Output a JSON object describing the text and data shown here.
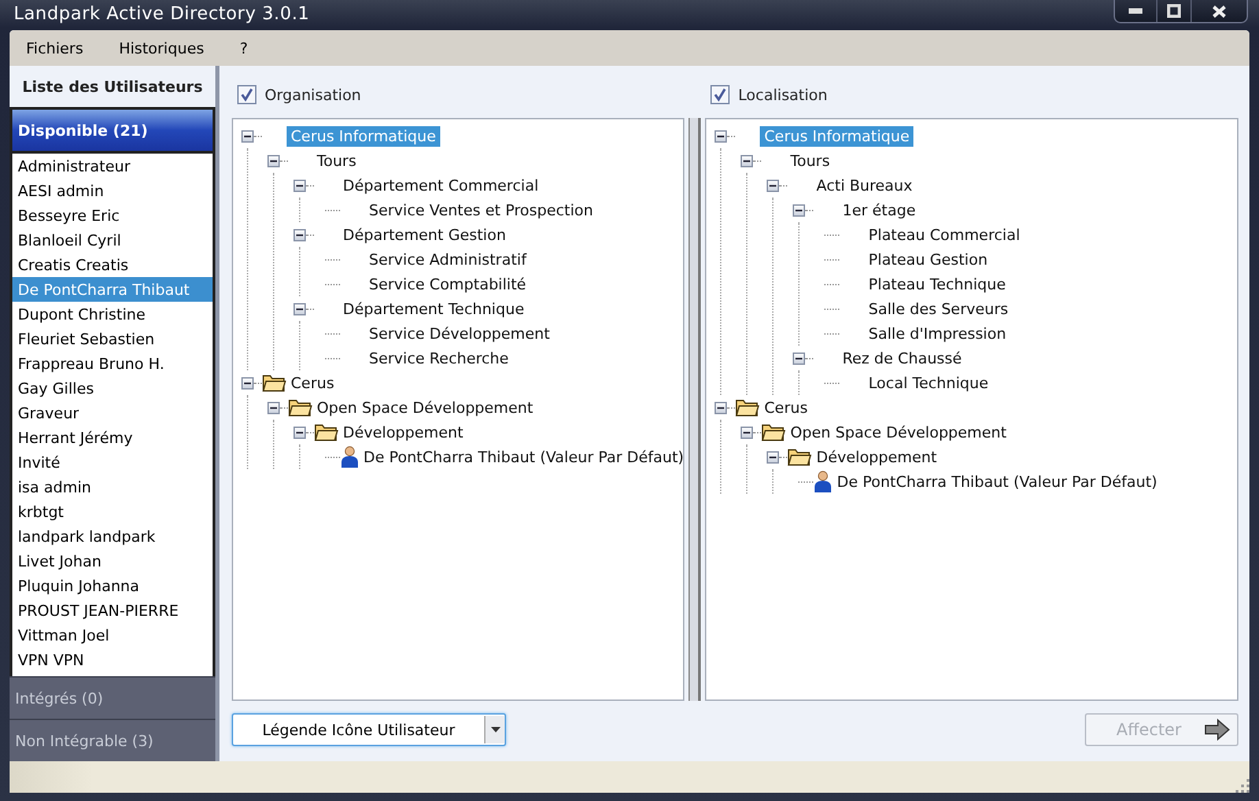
{
  "window": {
    "title": "Landpark Active Directory 3.0.1"
  },
  "menu": [
    "Fichiers",
    "Historiques",
    "?"
  ],
  "sidebar": {
    "title": "Liste des Utilisateurs",
    "groups": [
      {
        "label": "Disponible (21)",
        "selected": true,
        "users": [
          {
            "name": "Administrateur",
            "selected": false
          },
          {
            "name": "AESI admin",
            "selected": false
          },
          {
            "name": "Besseyre Eric",
            "selected": false
          },
          {
            "name": "Blanloeil Cyril",
            "selected": false
          },
          {
            "name": "Creatis Creatis",
            "selected": false
          },
          {
            "name": "De PontCharra Thibaut",
            "selected": true
          },
          {
            "name": "Dupont Christine",
            "selected": false
          },
          {
            "name": "Fleuriet Sebastien",
            "selected": false
          },
          {
            "name": "Frappreau Bruno H.",
            "selected": false
          },
          {
            "name": "Gay Gilles",
            "selected": false
          },
          {
            "name": "Graveur",
            "selected": false
          },
          {
            "name": "Herrant Jérémy",
            "selected": false
          },
          {
            "name": "Invité",
            "selected": false
          },
          {
            "name": "isa admin",
            "selected": false
          },
          {
            "name": "krbtgt",
            "selected": false
          },
          {
            "name": "landpark landpark",
            "selected": false
          },
          {
            "name": "Livet Johan",
            "selected": false
          },
          {
            "name": "Pluquin Johanna",
            "selected": false
          },
          {
            "name": "PROUST JEAN-PIERRE",
            "selected": false
          },
          {
            "name": "Vittman Joel",
            "selected": false
          },
          {
            "name": "VPN VPN",
            "selected": false
          }
        ]
      },
      {
        "label": "Intégrés (0)",
        "selected": false
      },
      {
        "label": "Non Intégrable (3)",
        "selected": false
      }
    ]
  },
  "panels": [
    {
      "label": "Organisation",
      "checked": true,
      "tree": [
        {
          "label": "Cerus Informatique",
          "kind": "node",
          "selected": true,
          "expanded": true,
          "children": [
            {
              "label": "Tours",
              "kind": "node",
              "selected": false,
              "expanded": true,
              "children": [
                {
                  "label": "Département Commercial",
                  "kind": "node",
                  "selected": false,
                  "expanded": true,
                  "children": [
                    {
                      "label": "Service Ventes et Prospection",
                      "kind": "node",
                      "selected": false
                    }
                  ]
                },
                {
                  "label": "Département Gestion",
                  "kind": "node",
                  "selected": false,
                  "expanded": true,
                  "children": [
                    {
                      "label": "Service Administratif",
                      "kind": "node",
                      "selected": false
                    },
                    {
                      "label": "Service Comptabilité",
                      "kind": "node",
                      "selected": false
                    }
                  ]
                },
                {
                  "label": "Département Technique",
                  "kind": "node",
                  "selected": false,
                  "expanded": true,
                  "children": [
                    {
                      "label": "Service Développement",
                      "kind": "node",
                      "selected": false
                    },
                    {
                      "label": "Service Recherche",
                      "kind": "node",
                      "selected": false
                    }
                  ]
                }
              ]
            }
          ]
        },
        {
          "label": "Cerus",
          "kind": "folder",
          "selected": false,
          "expanded": true,
          "children": [
            {
              "label": "Open Space Développement",
              "kind": "folder",
              "selected": false,
              "expanded": true,
              "children": [
                {
                  "label": "Développement",
                  "kind": "folder",
                  "selected": false,
                  "expanded": true,
                  "children": [
                    {
                      "label": "De PontCharra Thibaut (Valeur Par Défaut)",
                      "kind": "user",
                      "selected": false
                    }
                  ]
                }
              ]
            }
          ]
        }
      ]
    },
    {
      "label": "Localisation",
      "checked": true,
      "tree": [
        {
          "label": "Cerus Informatique",
          "kind": "node",
          "selected": true,
          "expanded": true,
          "children": [
            {
              "label": "Tours",
              "kind": "node",
              "selected": false,
              "expanded": true,
              "children": [
                {
                  "label": "Acti  Bureaux",
                  "kind": "node",
                  "selected": false,
                  "expanded": true,
                  "children": [
                    {
                      "label": "1er étage",
                      "kind": "node",
                      "selected": false,
                      "expanded": true,
                      "children": [
                        {
                          "label": "Plateau Commercial",
                          "kind": "node",
                          "selected": false
                        },
                        {
                          "label": "Plateau Gestion",
                          "kind": "node",
                          "selected": false
                        },
                        {
                          "label": "Plateau Technique",
                          "kind": "node",
                          "selected": false
                        },
                        {
                          "label": "Salle des Serveurs",
                          "kind": "node",
                          "selected": false
                        },
                        {
                          "label": "Salle d'Impression",
                          "kind": "node",
                          "selected": false
                        }
                      ]
                    },
                    {
                      "label": "Rez de Chaussé",
                      "kind": "node",
                      "selected": false,
                      "expanded": true,
                      "children": [
                        {
                          "label": "Local Technique",
                          "kind": "node",
                          "selected": false
                        }
                      ]
                    }
                  ]
                }
              ]
            }
          ]
        },
        {
          "label": "Cerus",
          "kind": "folder",
          "selected": false,
          "expanded": true,
          "children": [
            {
              "label": "Open Space Développement",
              "kind": "folder",
              "selected": false,
              "expanded": true,
              "children": [
                {
                  "label": "Développement",
                  "kind": "folder",
                  "selected": false,
                  "expanded": true,
                  "children": [
                    {
                      "label": "De PontCharra Thibaut (Valeur Par Défaut)",
                      "kind": "user",
                      "selected": false
                    }
                  ]
                }
              ]
            }
          ]
        }
      ]
    }
  ],
  "legend_dropdown": {
    "value": "Légende Icône Utilisateur"
  },
  "assign_button": {
    "label": "Affecter",
    "disabled": true
  }
}
